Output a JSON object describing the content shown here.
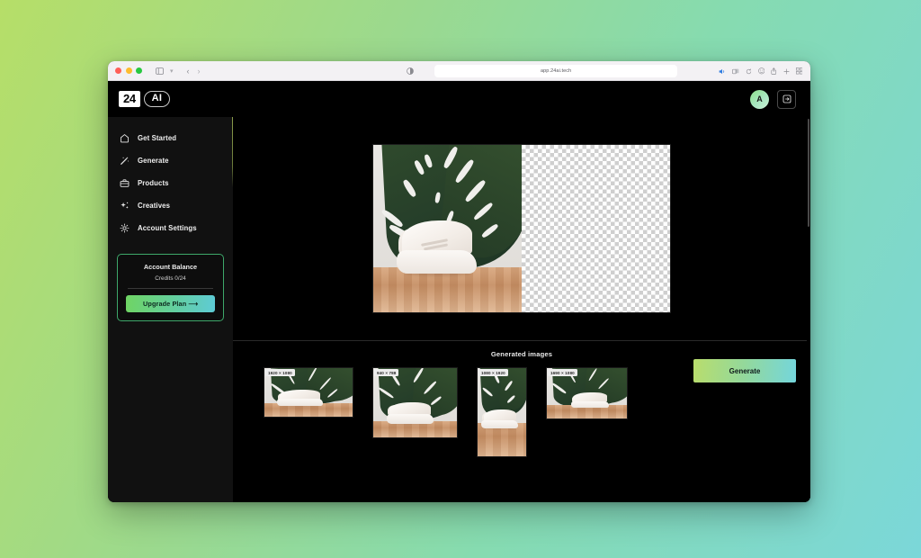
{
  "browser": {
    "url": "app.24ai.tech",
    "traffic_lights": [
      "close",
      "minimize",
      "maximize"
    ],
    "nav": {
      "back": "‹",
      "forward": "›"
    },
    "toolbar_icons": [
      "sidebar-toggle-icon",
      "contrast-icon",
      "audio-icon",
      "extensions-icon",
      "reload-icon",
      "profile-icon",
      "share-icon",
      "new-tab-icon",
      "tab-overview-icon"
    ]
  },
  "header": {
    "logo_primary": "24",
    "logo_secondary": "AI",
    "avatar_initial": "A",
    "logout_label": "Sign out"
  },
  "sidebar": {
    "items": [
      {
        "label": "Get Started",
        "icon": "home-icon"
      },
      {
        "label": "Generate",
        "icon": "magic-wand-icon"
      },
      {
        "label": "Products",
        "icon": "briefcase-icon"
      },
      {
        "label": "Creatives",
        "icon": "sparkles-icon"
      },
      {
        "label": "Account Settings",
        "icon": "gear-icon"
      }
    ],
    "balance": {
      "title": "Account Balance",
      "credits": "Credits 0/24",
      "upgrade_label": "Upgrade Plan ⟶"
    }
  },
  "main": {
    "preview": {
      "left_label": "original-product-photo",
      "right_label": "transparent-background-result"
    },
    "generated": {
      "title": "Generated images",
      "generate_label": "Generate",
      "thumbnails": [
        {
          "size": "1920 × 1080",
          "orientation": "landscape"
        },
        {
          "size": "940 × 788",
          "orientation": "landscape"
        },
        {
          "size": "1080 × 1920",
          "orientation": "portrait"
        },
        {
          "size": "1690 × 1080",
          "orientation": "landscape"
        }
      ]
    }
  },
  "colors": {
    "background_start": "#b6de68",
    "background_end": "#7bd7d9",
    "accent_gradient_start": "#b9dd6c",
    "accent_gradient_end": "#74d6dc",
    "card_border": "#3ea86a",
    "app_background": "#000000",
    "sidebar_background": "#111111"
  }
}
